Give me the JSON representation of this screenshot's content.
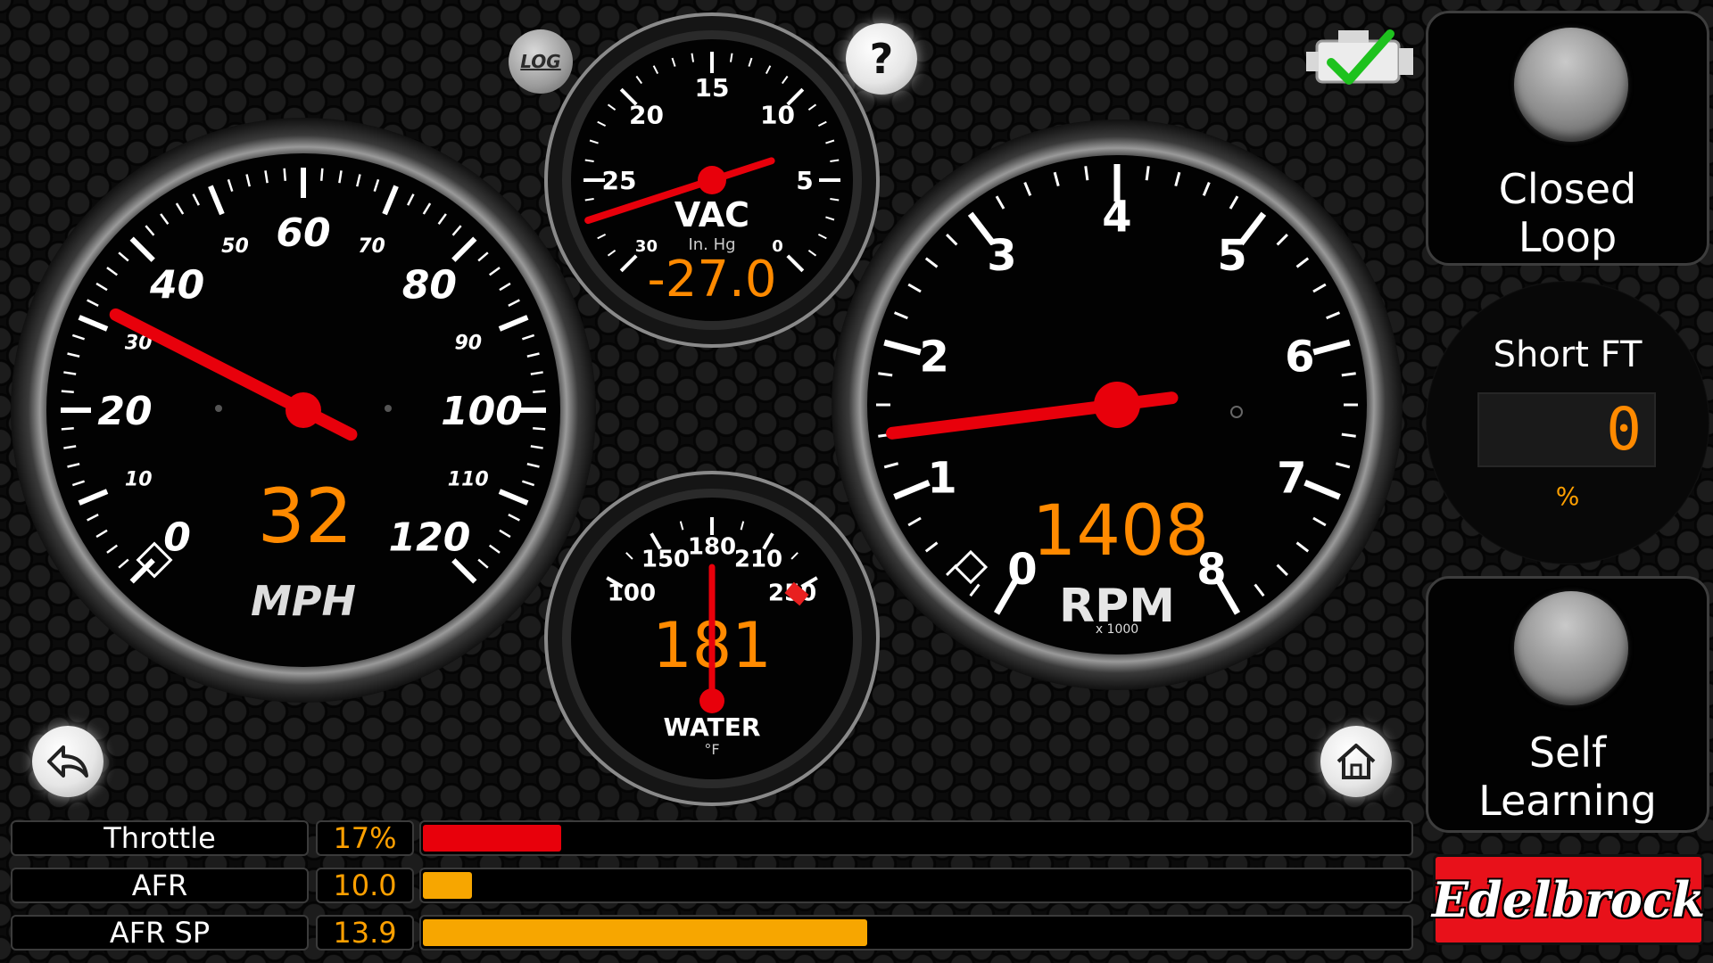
{
  "top": {
    "log_label": "LOG",
    "help_label": "?",
    "engine_status_icon": "check-engine-ok-icon"
  },
  "speedometer": {
    "ticks": [
      "0",
      "10",
      "20",
      "30",
      "40",
      "50",
      "60",
      "70",
      "80",
      "90",
      "100",
      "110",
      "120"
    ],
    "value": 32,
    "value_text": "32",
    "unit": "MPH"
  },
  "vacuum": {
    "ticks": [
      "0",
      "5",
      "10",
      "15",
      "20",
      "25",
      "30"
    ],
    "title": "VAC",
    "unit": "In. Hg",
    "value": -27.0,
    "value_text": "-27.0"
  },
  "water": {
    "ticks": [
      "100",
      "150",
      "180",
      "210",
      "250"
    ],
    "title": "WATER",
    "unit": "°F",
    "value": 181,
    "value_text": "181"
  },
  "tachometer": {
    "ticks": [
      "0",
      "1",
      "2",
      "3",
      "4",
      "5",
      "6",
      "7",
      "8"
    ],
    "value": 1408,
    "value_text": "1408",
    "unit": "RPM",
    "multiplier": "x 1000"
  },
  "panels": {
    "closed_loop": "Closed\nLoop",
    "short_ft_title": "Short FT",
    "short_ft_value": "0",
    "short_ft_unit": "%",
    "self_learning": "Self\nLearning"
  },
  "bars": [
    {
      "label": "Throttle",
      "value": "17%",
      "fraction": 0.14,
      "color": "#e8000b"
    },
    {
      "label": "AFR",
      "value": "10.0",
      "fraction": 0.05,
      "color": "#f7a600"
    },
    {
      "label": "AFR SP",
      "value": "13.9",
      "fraction": 0.45,
      "color": "#f7a600"
    }
  ],
  "nav": {
    "back_icon": "back-arrow-icon",
    "home_icon": "home-icon"
  },
  "brand": "Edelbrock"
}
